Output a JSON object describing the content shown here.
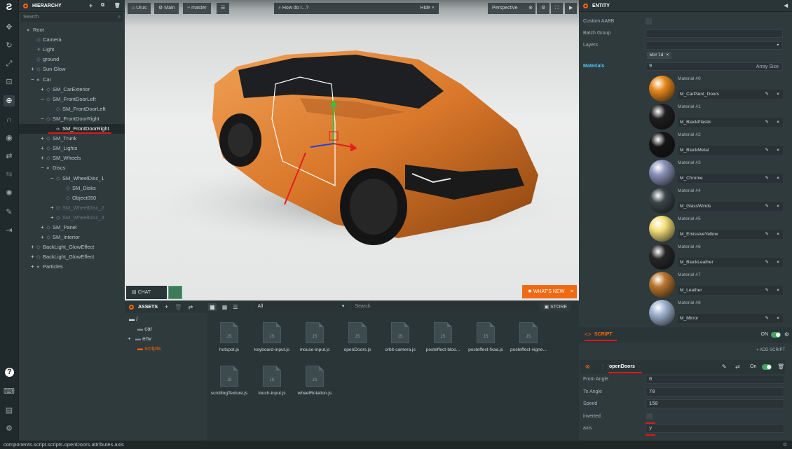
{
  "hierarchy": {
    "title": "HIERARCHY",
    "search_placeholder": "Search",
    "items": [
      {
        "label": "Root",
        "exp": "",
        "icon": "dot",
        "depth": 0
      },
      {
        "label": "Camera",
        "exp": "",
        "icon": "entity",
        "depth": 1
      },
      {
        "label": "Light",
        "exp": "",
        "icon": "light",
        "depth": 1
      },
      {
        "label": "ground",
        "exp": "",
        "icon": "entity",
        "depth": 1
      },
      {
        "label": "Sun Glow",
        "exp": "+",
        "icon": "entity",
        "depth": 1
      },
      {
        "label": "Car",
        "exp": "−",
        "icon": "dot",
        "depth": 1
      },
      {
        "label": "SM_CarExterior",
        "exp": "+",
        "icon": "entity",
        "depth": 2
      },
      {
        "label": "SM_FrontDoorLeft",
        "exp": "−",
        "icon": "entity",
        "depth": 2
      },
      {
        "label": "SM_FrontDoorLeft",
        "exp": "",
        "icon": "entity",
        "depth": 3
      },
      {
        "label": "SM_FrontDoorRight",
        "exp": "−",
        "icon": "entity",
        "depth": 2
      },
      {
        "label": "SM_FrontDoorRight",
        "exp": "",
        "icon": "script",
        "depth": 3,
        "selected": true
      },
      {
        "label": "SM_Trunk",
        "exp": "+",
        "icon": "entity",
        "depth": 2
      },
      {
        "label": "SM_Lights",
        "exp": "+",
        "icon": "entity",
        "depth": 2
      },
      {
        "label": "SM_Wheels",
        "exp": "+",
        "icon": "entity",
        "depth": 2
      },
      {
        "label": "Discs",
        "exp": "−",
        "icon": "dot",
        "depth": 2
      },
      {
        "label": "SM_WheelDisc_1",
        "exp": "−",
        "icon": "entity",
        "depth": 3
      },
      {
        "label": "SM_Disks",
        "exp": "",
        "icon": "entity",
        "depth": 4
      },
      {
        "label": "Object050",
        "exp": "",
        "icon": "entity",
        "depth": 4
      },
      {
        "label": "SM_WheelDisc_2",
        "exp": "+",
        "icon": "entity",
        "depth": 3,
        "dim": true
      },
      {
        "label": "SM_WheelDisc_3",
        "exp": "+",
        "icon": "entity",
        "depth": 3,
        "dim": true
      },
      {
        "label": "SM_Panel",
        "exp": "+",
        "icon": "entity",
        "depth": 2
      },
      {
        "label": "SM_Interior",
        "exp": "+",
        "icon": "entity",
        "depth": 2
      },
      {
        "label": "BackLight_GlowEffect",
        "exp": "+",
        "icon": "entity",
        "depth": 1
      },
      {
        "label": "BackLight_GlowEffect",
        "exp": "+",
        "icon": "entity",
        "depth": 1
      },
      {
        "label": "Particles",
        "exp": "+",
        "icon": "dot",
        "depth": 1
      }
    ]
  },
  "viewport": {
    "project": "Urus",
    "scene": "Main",
    "branch": "master",
    "search_placeholder": "How do I...?",
    "hide_label": "Hide",
    "camera": "Perspective",
    "chat_label": "CHAT",
    "whats_new_label": "WHAT'S NEW"
  },
  "assets": {
    "title": "ASSETS",
    "filter": "All",
    "search_placeholder": "Search",
    "store_label": "STORE",
    "tree_root": "/",
    "folders": [
      "car",
      "env",
      "scripts"
    ],
    "files": [
      "hotspot.js",
      "keyboard-input.js",
      "mouse-input.js",
      "openDoors.js",
      "orbit-camera.js",
      "posteffect-bloo...",
      "posteffect-fxaa.js",
      "posteffect-vigne...",
      "scrollingTexture.js",
      "touch-input.js",
      "wheelRotation.js"
    ],
    "file_badge": "JS"
  },
  "entity": {
    "title": "ENTITY",
    "custom_aabb_label": "Custom AABB",
    "batch_group_label": "Batch Group",
    "layers_label": "Layers",
    "layer_tag": "World",
    "materials_label": "Materials",
    "materials_count": "9",
    "array_size_label": "Array Size",
    "materials": [
      {
        "slot": "Material #0",
        "name": "M_CarPaint_Doors",
        "color": "#e8891c"
      },
      {
        "slot": "Material #1",
        "name": "M_BlackPlastic",
        "color": "#1e1e1e"
      },
      {
        "slot": "Material #2",
        "name": "M_BlackMetal",
        "color": "#151515"
      },
      {
        "slot": "Material #3",
        "name": "M_Chrome",
        "color": "#8a93b8"
      },
      {
        "slot": "Material #4",
        "name": "M_GlassWinds",
        "color": "#3a4447"
      },
      {
        "slot": "Material #5",
        "name": "M_EmissiveYellow",
        "color": "#f4e07a"
      },
      {
        "slot": "Material #6",
        "name": "M_BlackLeather",
        "color": "#262626"
      },
      {
        "slot": "Material #7",
        "name": "M_Leather",
        "color": "#b8762e"
      },
      {
        "slot": "Material #8",
        "name": "M_Mirror",
        "color": "#9fb3cf"
      }
    ]
  },
  "script": {
    "title": "SCRIPT",
    "on_label": "ON",
    "add_script_label": "+ ADD SCRIPT",
    "instance_name": "openDoors",
    "instance_on": "On",
    "attributes": [
      {
        "label": "From Angle",
        "value": "0"
      },
      {
        "label": "To Angle",
        "value": "70"
      },
      {
        "label": "Speed",
        "value": "150"
      },
      {
        "label": "inverted",
        "value": ""
      },
      {
        "label": "axis",
        "value": "y"
      }
    ]
  },
  "status_bar": {
    "path": "components.script.scripts.openDoors.attributes.axis",
    "count": "0"
  },
  "colors": {
    "accent": "#ff6600",
    "whats_new": "#f06a14",
    "highlight": "#e01818"
  }
}
